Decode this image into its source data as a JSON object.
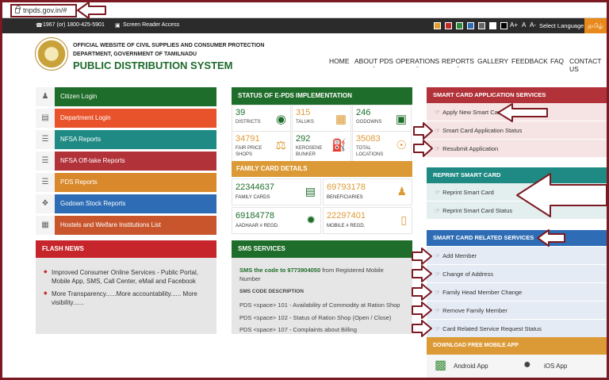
{
  "browser": {
    "url": "tnpds.gov.in/#"
  },
  "topbar": {
    "helpline": "1967 (or) 1800-425-5901",
    "screen_reader": "Screen Reader Access",
    "font_small": "A+",
    "font_normal": "A",
    "font_large": "A-",
    "select_language": "Select Language",
    "tamil": "தமிழ்"
  },
  "header": {
    "org_line1": "OFFICIAL WEBSITE OF CIVIL SUPPLIES AND CONSUMER PROTECTION",
    "org_line2": "DEPARTMENT, GOVERNMENT OF TAMILNADU",
    "title": "PUBLIC DISTRIBUTION SYSTEM"
  },
  "nav": [
    "HOME",
    "ABOUT PDS",
    "OPERATIONS",
    "REPORTS",
    "GALLERY",
    "FEEDBACK",
    "FAQ",
    "CONTACT US"
  ],
  "left_menu": [
    "Citizen Login",
    "Department Login",
    "NFSA Reports",
    "NFSA Off-take Reports",
    "PDS Reports",
    "Godown Stock Reports",
    "Hostels and Welfare Institutions List"
  ],
  "flash": {
    "title": "FLASH NEWS",
    "items": [
      "Improved Consumer Online Services - Public Portal, Mobile App, SMS, Call Center, eMail and Facebook",
      "More Transparency......More accountability...... More visibility......"
    ]
  },
  "status": {
    "title": "STATUS OF E-PDS IMPLEMENTATION",
    "stats": [
      {
        "value": "39",
        "label": "DISTRICTS"
      },
      {
        "value": "315",
        "label": "TALUKS"
      },
      {
        "value": "246",
        "label": "GODOWNS"
      },
      {
        "value": "34791",
        "label": "FAIR PRICE SHOPS"
      },
      {
        "value": "292",
        "label": "KEROSENE BUNKER"
      },
      {
        "value": "35083",
        "label": "TOTAL LOCATIONS"
      }
    ]
  },
  "family": {
    "title": "FAMILY CARD DETAILS",
    "cards": [
      {
        "value": "22344637",
        "label": "FAMILY CARDS"
      },
      {
        "value": "69793178",
        "label": "BENEFICIARIES"
      },
      {
        "value": "69184778",
        "label": "AADHAAR # REGD."
      },
      {
        "value": "22297401",
        "label": "MOBILE # REGD."
      }
    ]
  },
  "sms": {
    "title": "SMS SERVICES",
    "intro_bold": "SMS the code to 9773904050",
    "intro_rest": " from Registered Mobile Number",
    "code_desc": "SMS CODE DESCRIPTION",
    "codes": [
      "PDS <space> 101 - Availability of Commodity at Ration Shop",
      "PDS <space> 102 - Status of Ration Shop (Open / Close)",
      "PDS <space> 107 - Complaints about Billing"
    ]
  },
  "smart_card_app": {
    "title": "SMART CARD APPLICATION SERVICES",
    "items": [
      "Apply New Smart Card",
      "Smart Card Application Status",
      "Resubmit Application"
    ]
  },
  "reprint": {
    "title": "REPRINT SMART CARD",
    "items": [
      "Reprint Smart Card",
      "Reprint Smart Card Status"
    ]
  },
  "related": {
    "title": "SMART CARD RELATED SERVICES",
    "items": [
      "Add Member",
      "Change of Address",
      "Family Head Member Change",
      "Remove Family Member",
      "Card Related Service Request Status"
    ]
  },
  "download": {
    "title": "DOWNLOAD FREE MOBILE APP",
    "android": "Android App",
    "ios": "iOS App"
  },
  "colors": {
    "green": "#1f6d2a",
    "red": "#c6262b",
    "orange": "#dc9a36",
    "teal": "#1f8a84",
    "blue": "#2e6db5",
    "maroon_arrow": "#7b1a22"
  }
}
